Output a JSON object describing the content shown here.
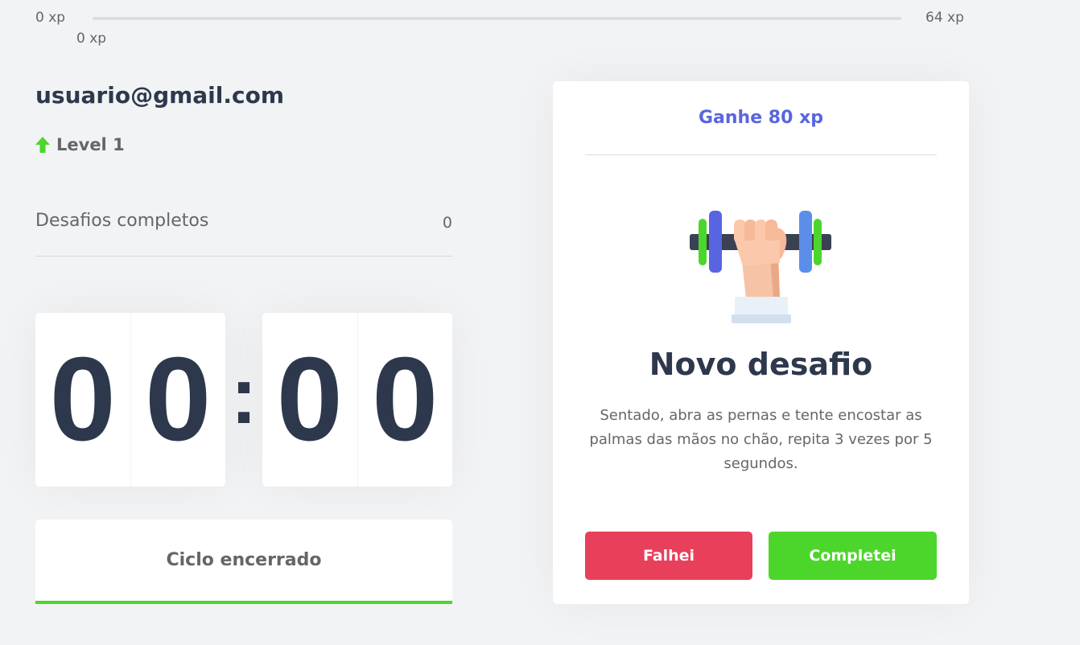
{
  "xp": {
    "min_label": "0 xp",
    "current_label": "0 xp",
    "max_label": "64 xp",
    "progress_fraction": 0
  },
  "profile": {
    "email": "usuario@gmail.com",
    "level_label": "Level 1",
    "level_icon": "up-arrow-icon"
  },
  "completed_challenges": {
    "label": "Desafios completos",
    "value": "0"
  },
  "countdown": {
    "minutes": [
      "0",
      "0"
    ],
    "seconds": [
      "0",
      "0"
    ],
    "separator": ":"
  },
  "cycle_button": {
    "label": "Ciclo encerrado"
  },
  "challenge": {
    "reward": "Ganhe 80 xp",
    "icon": "dumbbell-icon",
    "title": "Novo desafio",
    "description": "Sentado, abra as pernas e tente encostar as palmas das mãos no chão, repita 3 vezes por 5 segundos.",
    "failed_label": "Falhei",
    "completed_label": "Completei"
  },
  "colors": {
    "background": "#f2f3f5",
    "text": "#666666",
    "title": "#2e384d",
    "accent_blue": "#5965e0",
    "green": "#4cd62b",
    "red": "#e83f5b"
  }
}
